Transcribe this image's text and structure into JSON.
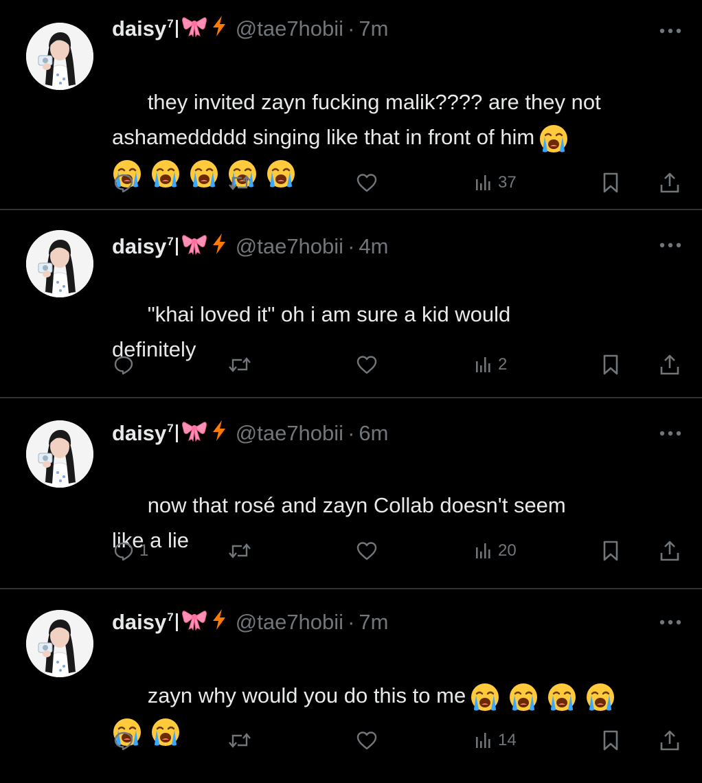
{
  "colors": {
    "background": "#000000",
    "text": "#e7e9ea",
    "muted": "#71767b",
    "divider": "#2f3336",
    "bolt": "#ff7a00",
    "bow": "#ff8fb3"
  },
  "icons": {
    "reply": "reply-icon",
    "retweet": "retweet-icon",
    "like": "heart-icon",
    "views": "views-icon",
    "bookmark": "bookmark-icon",
    "share": "share-icon",
    "more": "more-icon",
    "emoji": "loudly-crying-face-emoji"
  },
  "tweets": [
    {
      "name": "daisy",
      "name_sup": "7",
      "handle": "@tae7hobii",
      "sep": "·",
      "time": "7m",
      "text": "they invited zayn fucking malik???? are they not\nashameddddd singing like that in front of him",
      "inline_emojis": 1,
      "next_line_emojis": 5,
      "reply_count": "",
      "views": "37"
    },
    {
      "name": "daisy",
      "name_sup": "7",
      "handle": "@tae7hobii",
      "sep": "·",
      "time": "4m",
      "text": "\"khai loved it\" oh i am sure a kid would\ndefinitely",
      "inline_emojis": 0,
      "next_line_emojis": 0,
      "reply_count": "",
      "views": "2"
    },
    {
      "name": "daisy",
      "name_sup": "7",
      "handle": "@tae7hobii",
      "sep": "·",
      "time": "6m",
      "text": "now that rosé and zayn Collab doesn't seem\nlike a lie",
      "inline_emojis": 0,
      "next_line_emojis": 0,
      "reply_count": "1",
      "views": "20"
    },
    {
      "name": "daisy",
      "name_sup": "7",
      "handle": "@tae7hobii",
      "sep": "·",
      "time": "7m",
      "text": "zayn why would you do this to me",
      "inline_emojis": 4,
      "next_line_emojis": 2,
      "reply_count": "",
      "views": "14"
    }
  ]
}
